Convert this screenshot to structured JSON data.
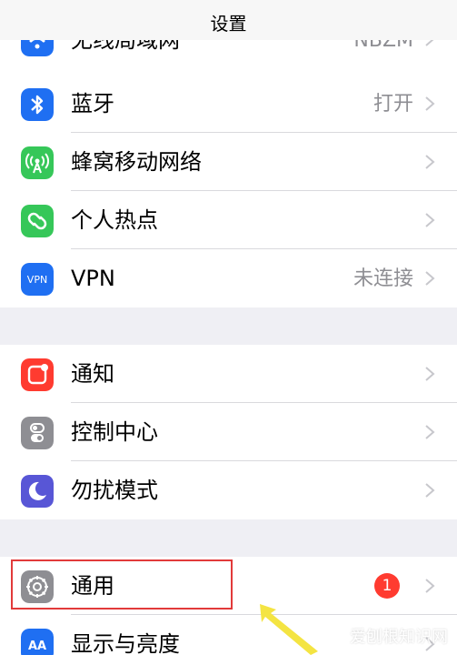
{
  "nav": {
    "title": "设置"
  },
  "rows": [
    {
      "id": "wlan",
      "label": "无线局域网",
      "value": "NBZM",
      "icon": "wifi-icon",
      "icon_color": "#1f6ff2"
    },
    {
      "id": "bluetooth",
      "label": "蓝牙",
      "value": "打开",
      "icon": "bluetooth-icon",
      "icon_color": "#1f6ff2"
    },
    {
      "id": "cellular",
      "label": "蜂窝移动网络",
      "value": "",
      "icon": "cellular-icon",
      "icon_color": "#36c759"
    },
    {
      "id": "hotspot",
      "label": "个人热点",
      "value": "",
      "icon": "hotspot-icon",
      "icon_color": "#36c759"
    },
    {
      "id": "vpn",
      "label": "VPN",
      "value": "未连接",
      "icon": "vpn-icon",
      "icon_text": "VPN",
      "icon_color": "#1f6ff2"
    },
    {
      "id": "notifications",
      "label": "通知",
      "value": "",
      "icon": "notifications-icon",
      "icon_color": "#ff3b30"
    },
    {
      "id": "control-center",
      "label": "控制中心",
      "value": "",
      "icon": "control-center-icon",
      "icon_color": "#8e8e93"
    },
    {
      "id": "do-not-disturb",
      "label": "勿扰模式",
      "value": "",
      "icon": "moon-icon",
      "icon_color": "#5856d6"
    },
    {
      "id": "general",
      "label": "通用",
      "value": "",
      "badge": "1",
      "icon": "gear-icon",
      "icon_color": "#8e8e93"
    },
    {
      "id": "display",
      "label": "显示与亮度",
      "value": "",
      "icon": "display-brightness-icon",
      "icon_text": "AA",
      "icon_color": "#1f6ff2"
    }
  ],
  "colors": {
    "background": "#efeff4",
    "highlight_border": "#e23a3a",
    "arrow": "#f4e442",
    "badge": "#ff3b30"
  },
  "watermark": "爱刨根知识网"
}
